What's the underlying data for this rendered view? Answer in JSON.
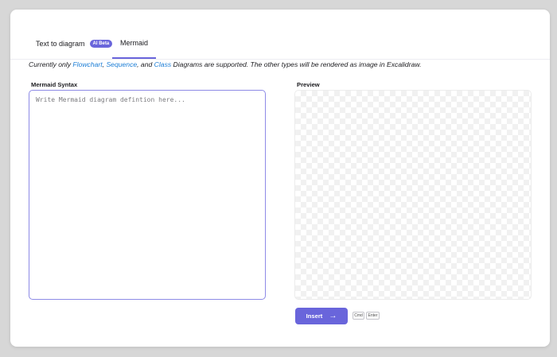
{
  "tabs": {
    "text_to_diagram": "Text to diagram",
    "ai_badge": "AI Beta",
    "mermaid": "Mermaid"
  },
  "notice": {
    "prefix": "Currently only ",
    "flowchart": "Flowchart",
    "sep1": ", ",
    "sequence": "Sequence",
    "sep2": ", and ",
    "class": "Class",
    "suffix": " Diagrams are supported. The other types will be rendered as image in Excalidraw."
  },
  "editor": {
    "label": "Mermaid Syntax",
    "value": "",
    "placeholder": "Write Mermaid diagram defintion here..."
  },
  "preview": {
    "label": "Preview"
  },
  "actions": {
    "insert_label": "Insert",
    "insert_arrow": "→",
    "shortcut_cmd": "Cmd",
    "shortcut_enter": "Enter"
  },
  "colors": {
    "accent": "#6965db",
    "link": "#1c7ed6"
  }
}
